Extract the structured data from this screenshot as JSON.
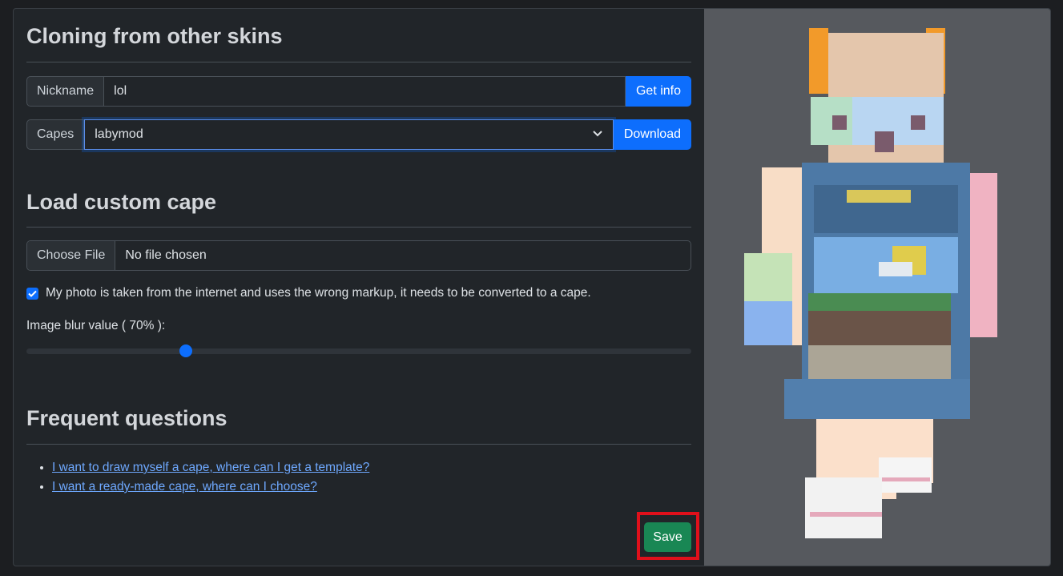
{
  "cloning": {
    "heading": "Cloning from other skins",
    "nickname_label": "Nickname",
    "nickname_value": "lol",
    "get_info_label": "Get info",
    "capes_label": "Capes",
    "capes_selected": "labymod",
    "download_label": "Download"
  },
  "custom_cape": {
    "heading": "Load custom cape",
    "choose_file_label": "Choose File",
    "file_status": "No file chosen",
    "convert_checkbox_label": "My photo is taken from the internet and uses the wrong markup, it needs to be converted to a cape.",
    "convert_checked": true,
    "blur_label": "Image blur value ( 70% ):",
    "blur_value_fraction": 0.24
  },
  "faq": {
    "heading": "Frequent questions",
    "links": [
      "I want to draw myself a cape, where can I get a template?",
      "I want a ready-made cape, where can I choose?"
    ]
  },
  "actions": {
    "save_label": "Save"
  },
  "colors": {
    "primary": "#0d6efd",
    "success": "#198754",
    "highlight": "#e0101b",
    "preview_bg": "#56595e"
  }
}
